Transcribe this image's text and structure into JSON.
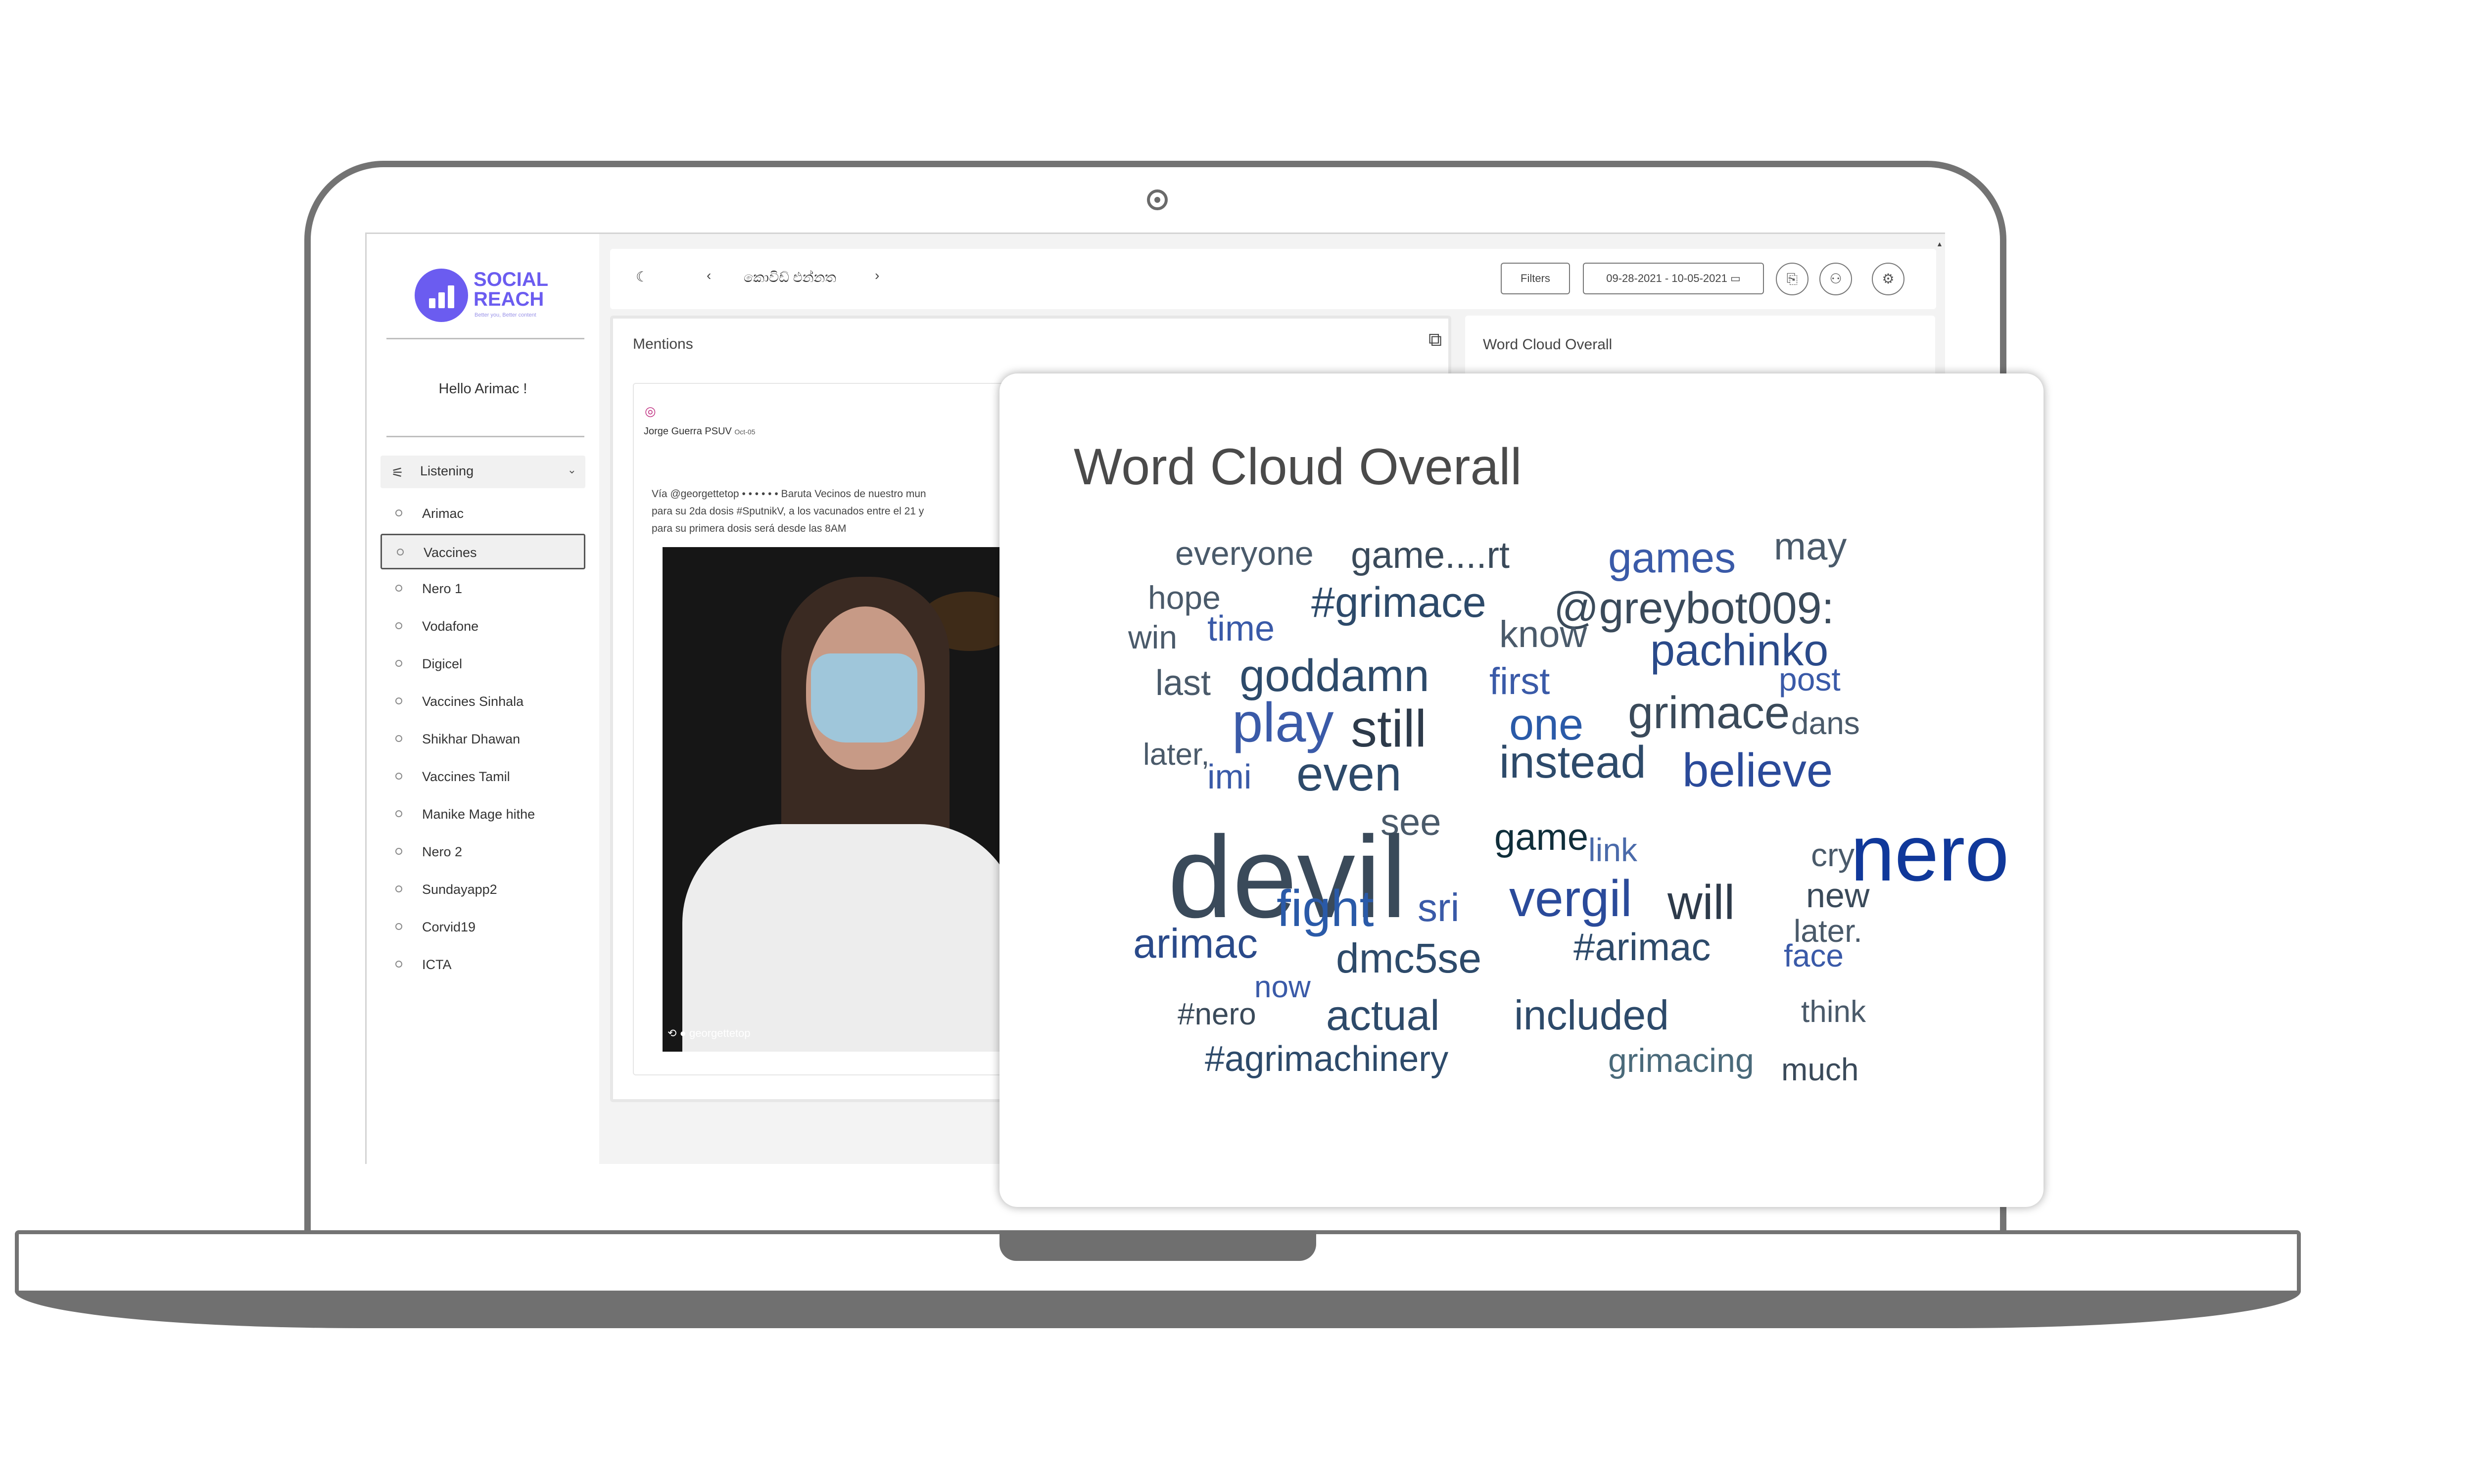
{
  "app": {
    "logo_line1": "SOCIAL",
    "logo_line2": "REACH",
    "logo_tagline": "Better you, Better content",
    "greeting": "Hello Arimac !",
    "brand_color": "#6b5cf0"
  },
  "sidebar": {
    "section_label": "Listening",
    "items": [
      {
        "label": "Arimac"
      },
      {
        "label": "Vaccines",
        "active": true
      },
      {
        "label": "Nero 1"
      },
      {
        "label": "Vodafone"
      },
      {
        "label": "Digicel"
      },
      {
        "label": "Vaccines Sinhala"
      },
      {
        "label": "Shikhar Dhawan"
      },
      {
        "label": "Vaccines Tamil"
      },
      {
        "label": "Manike Mage hithe"
      },
      {
        "label": "Nero 2"
      },
      {
        "label": "Sundayapp2"
      },
      {
        "label": "Corvid19"
      },
      {
        "label": "ICTA"
      }
    ]
  },
  "topbar": {
    "theme_icon": "moon-icon",
    "prev_icon": "chevron-left-icon",
    "title": "කොවිඩ් එන්නත",
    "next_icon": "chevron-right-icon",
    "filters_label": "Filters",
    "date_range": "09-28-2021 - 10-05-2021"
  },
  "mentions": {
    "title": "Mentions",
    "post": {
      "author": "Jorge Guerra PSUV",
      "date": "Oct-05",
      "text": "Vía @georgettetop • • • • • • Baruta Vecinos de nuestro mun\npara su 2da dosis #SputnikV, a los vacunados entre el 21 y \npara su primera dosis será desde las 8AM",
      "video_caption": "georgettetop"
    }
  },
  "word_cloud_small": {
    "title": "Word Cloud Overall"
  },
  "word_cloud": {
    "title": "Word Cloud Overall",
    "words": [
      {
        "text": "everyone",
        "color": "#4a5a6a"
      },
      {
        "text": "game....rt",
        "color": "#3a4a5a"
      },
      {
        "text": "games",
        "color": "#3a5aa8"
      },
      {
        "text": "may",
        "color": "#4a5a6a"
      },
      {
        "text": "hope",
        "color": "#4a5a6a"
      },
      {
        "text": "#grimace",
        "color": "#2d4a6a"
      },
      {
        "text": "@greybot009:",
        "color": "#3a4a5a"
      },
      {
        "text": "win",
        "color": "#4a5a6a"
      },
      {
        "text": "time",
        "color": "#3a5aa8"
      },
      {
        "text": "know",
        "color": "#4a5a6a"
      },
      {
        "text": "pachinko",
        "color": "#2a4a8a"
      },
      {
        "text": "last",
        "color": "#4a5a6a"
      },
      {
        "text": "goddamn",
        "color": "#2d4a6a"
      },
      {
        "text": "first",
        "color": "#3a5aa8"
      },
      {
        "text": "post",
        "color": "#3a5aa8"
      },
      {
        "text": "play",
        "color": "#3a5aa8"
      },
      {
        "text": "still",
        "color": "#2d3a4a"
      },
      {
        "text": "one",
        "color": "#2a5aa8"
      },
      {
        "text": "grimace",
        "color": "#3a4a5a"
      },
      {
        "text": "dans",
        "color": "#4a5a6a"
      },
      {
        "text": "later,",
        "color": "#4a5a6a"
      },
      {
        "text": "imi",
        "color": "#3a5aa8"
      },
      {
        "text": "even",
        "color": "#2d4a6a"
      },
      {
        "text": "instead",
        "color": "#2d4a6a"
      },
      {
        "text": "believe",
        "color": "#2a4a9a"
      },
      {
        "text": "see",
        "color": "#4a5a6a"
      },
      {
        "text": "game",
        "color": "#0f2e3a"
      },
      {
        "text": "devil",
        "color": "#3a4a5a"
      },
      {
        "text": "nero",
        "color": "#10389a"
      },
      {
        "text": "link",
        "color": "#4a6aaa"
      },
      {
        "text": "cry",
        "color": "#4a5a6a"
      },
      {
        "text": "fight",
        "color": "#2a5aa8"
      },
      {
        "text": "sri",
        "color": "#3a5aa8"
      },
      {
        "text": "vergil",
        "color": "#2a4a9a"
      },
      {
        "text": "will",
        "color": "#2d3a4a"
      },
      {
        "text": "new",
        "color": "#3a4a5a"
      },
      {
        "text": "later.",
        "color": "#4a5a6a"
      },
      {
        "text": "arimac",
        "color": "#2a4a8a"
      },
      {
        "text": "dmc5se",
        "color": "#2d4a6a"
      },
      {
        "text": "#arimac",
        "color": "#2d4a6a"
      },
      {
        "text": "face",
        "color": "#3a5aa8"
      },
      {
        "text": "now",
        "color": "#3a5aa8"
      },
      {
        "text": "#nero",
        "color": "#3a4a5a"
      },
      {
        "text": "actual",
        "color": "#2d4a6a"
      },
      {
        "text": "included",
        "color": "#2d4a6a"
      },
      {
        "text": "think",
        "color": "#4a5a6a"
      },
      {
        "text": "#agrimachinery",
        "color": "#2d4a6a"
      },
      {
        "text": "grimacing",
        "color": "#4a6a7a"
      },
      {
        "text": "much",
        "color": "#3a4a5a"
      }
    ]
  }
}
